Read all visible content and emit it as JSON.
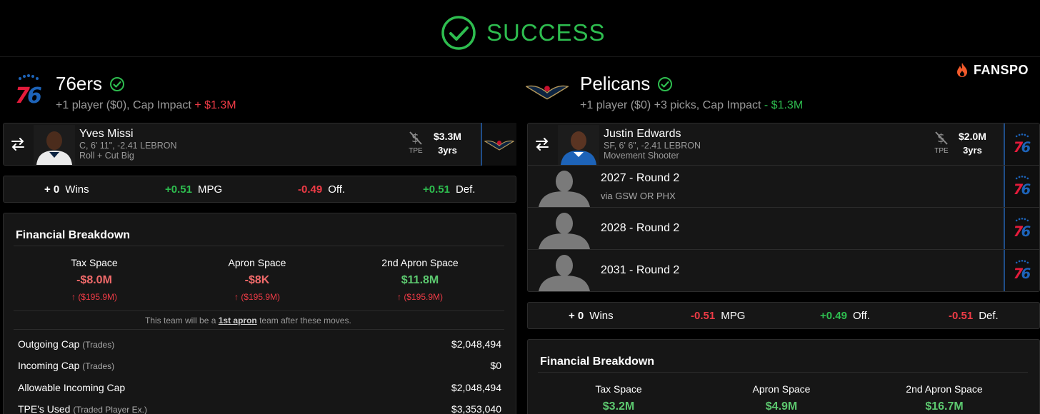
{
  "banner": {
    "text": "SUCCESS"
  },
  "brand": {
    "name": "FANSPO"
  },
  "colors": {
    "success": "#2ebd4f",
    "negative": "#ee3b46",
    "accent_blue": "#1f4d88"
  },
  "left": {
    "team": "76ers",
    "summary_prefix": "+1 player ($0), Cap Impact",
    "summary_value": "+ $1.3M",
    "player": {
      "name": "Yves Missi",
      "meta1": "C, 6' 11\", -2.41 LEBRON",
      "meta2": "Roll + Cut Big",
      "tpe": "TPE",
      "salary": "$3.3M",
      "years": "3yrs",
      "to_team_icon": "pelicans-logo"
    },
    "impact": [
      {
        "value": "+ 0",
        "label": "Wins",
        "tone": "neutral"
      },
      {
        "value": "+0.51",
        "label": "MPG",
        "tone": "pos"
      },
      {
        "value": "-0.49",
        "label": "Off.",
        "tone": "neg"
      },
      {
        "value": "+0.51",
        "label": "Def.",
        "tone": "pos"
      }
    ],
    "financial": {
      "title": "Financial Breakdown",
      "cols": [
        {
          "label": "Tax Space",
          "value": "-$8.0M",
          "sub": "($195.9M)"
        },
        {
          "label": "Apron Space",
          "value": "-$8K",
          "sub": "($195.9M)"
        },
        {
          "label": "2nd Apron Space",
          "value": "$11.8M",
          "sub": "($195.9M)"
        }
      ],
      "note_pre": "This team will be a",
      "note_link": "1st apron",
      "note_post": "team after these moves.",
      "items": [
        {
          "label": "Outgoing Cap",
          "paren": "(Trades)",
          "value": "$2,048,494"
        },
        {
          "label": "Incoming Cap",
          "paren": "(Trades)",
          "value": "$0"
        },
        {
          "label": "Allowable Incoming Cap",
          "paren": "",
          "value": "$2,048,494"
        },
        {
          "label": "TPE's Used",
          "paren": "(Traded Player Ex.)",
          "value": "$3,353,040"
        }
      ]
    }
  },
  "right": {
    "team": "Pelicans",
    "summary_prefix": "+1 player ($0) +3 picks, Cap Impact",
    "summary_value": "- $1.3M",
    "player": {
      "name": "Justin Edwards",
      "meta1": "SF, 6' 6\", -2.41 LEBRON",
      "meta2": "Movement Shooter",
      "tpe": "TPE",
      "salary": "$2.0M",
      "years": "3yrs",
      "to_team_icon": "76ers-logo"
    },
    "picks": [
      {
        "label": "2027 - Round 2",
        "sub": "via GSW OR PHX"
      },
      {
        "label": "2028 - Round 2",
        "sub": ""
      },
      {
        "label": "2031 - Round 2",
        "sub": ""
      }
    ],
    "impact": [
      {
        "value": "+ 0",
        "label": "Wins",
        "tone": "neutral"
      },
      {
        "value": "-0.51",
        "label": "MPG",
        "tone": "neg"
      },
      {
        "value": "+0.49",
        "label": "Off.",
        "tone": "pos"
      },
      {
        "value": "-0.51",
        "label": "Def.",
        "tone": "neg"
      }
    ],
    "financial": {
      "title": "Financial Breakdown",
      "cols": [
        {
          "label": "Tax Space",
          "value": "$3.2M"
        },
        {
          "label": "Apron Space",
          "value": "$4.9M"
        },
        {
          "label": "2nd Apron Space",
          "value": "$16.7M"
        }
      ]
    }
  }
}
